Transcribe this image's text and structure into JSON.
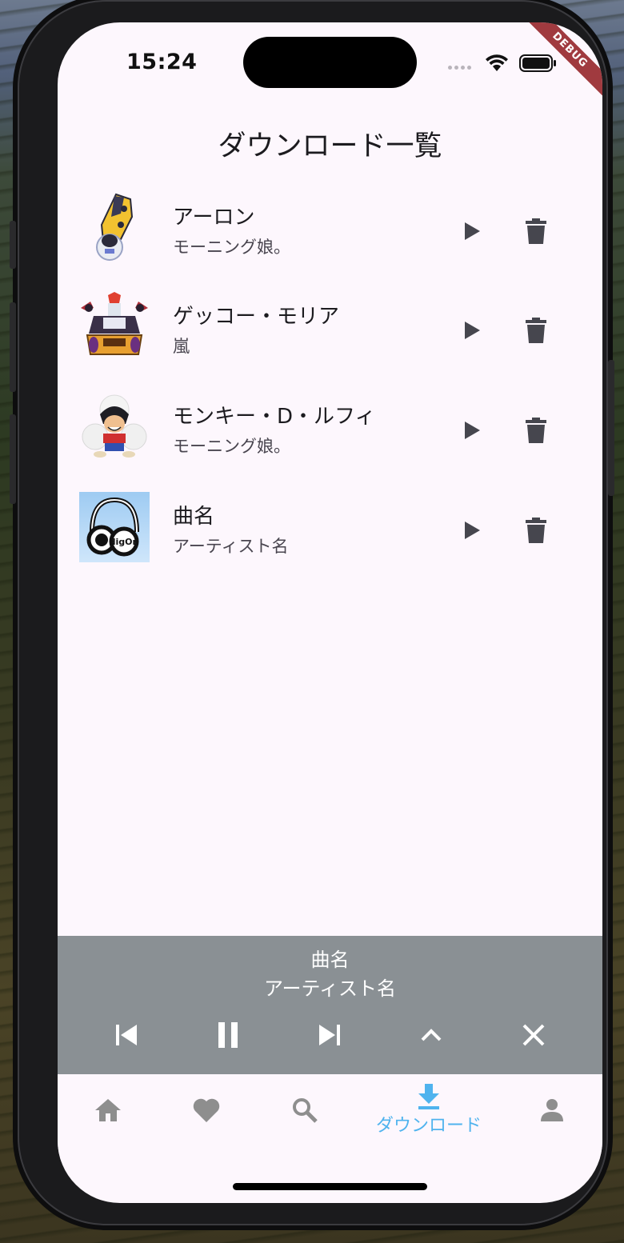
{
  "status_bar": {
    "time": "15:24",
    "debug_banner": "DEBUG"
  },
  "page": {
    "title": "ダウンロード一覧"
  },
  "downloads": [
    {
      "title": "アーロン",
      "artist": "モーニング娘。",
      "thumbnail": "aaron-art"
    },
    {
      "title": "ゲッコー・モリア",
      "artist": "嵐",
      "thumbnail": "moria-art"
    },
    {
      "title": "モンキー・D・ルフィ",
      "artist": "モーニング娘。",
      "thumbnail": "luffy-art"
    },
    {
      "title": "曲名",
      "artist": "アーティスト名",
      "thumbnail": "digon-art"
    }
  ],
  "row_actions": {
    "play_icon": "play-icon",
    "delete_icon": "trash-icon"
  },
  "mini_player": {
    "title": "曲名",
    "artist": "アーティスト名",
    "controls": [
      "skip-previous-icon",
      "pause-icon",
      "skip-next-icon",
      "expand-up-icon",
      "close-icon"
    ]
  },
  "bottom_nav": {
    "items": [
      {
        "icon": "home-icon",
        "label": ""
      },
      {
        "icon": "heart-icon",
        "label": ""
      },
      {
        "icon": "search-icon",
        "label": ""
      },
      {
        "icon": "download-icon",
        "label": "ダウンロード",
        "active": true
      },
      {
        "icon": "person-icon",
        "label": ""
      }
    ]
  },
  "colors": {
    "background": "#fdf7fd",
    "mini_player": "#8a9094",
    "active_nav": "#4fb3ee",
    "inactive_icon": "#8e8e8e",
    "row_icon": "#46464e",
    "debug_ribbon": "#a03a3f"
  }
}
